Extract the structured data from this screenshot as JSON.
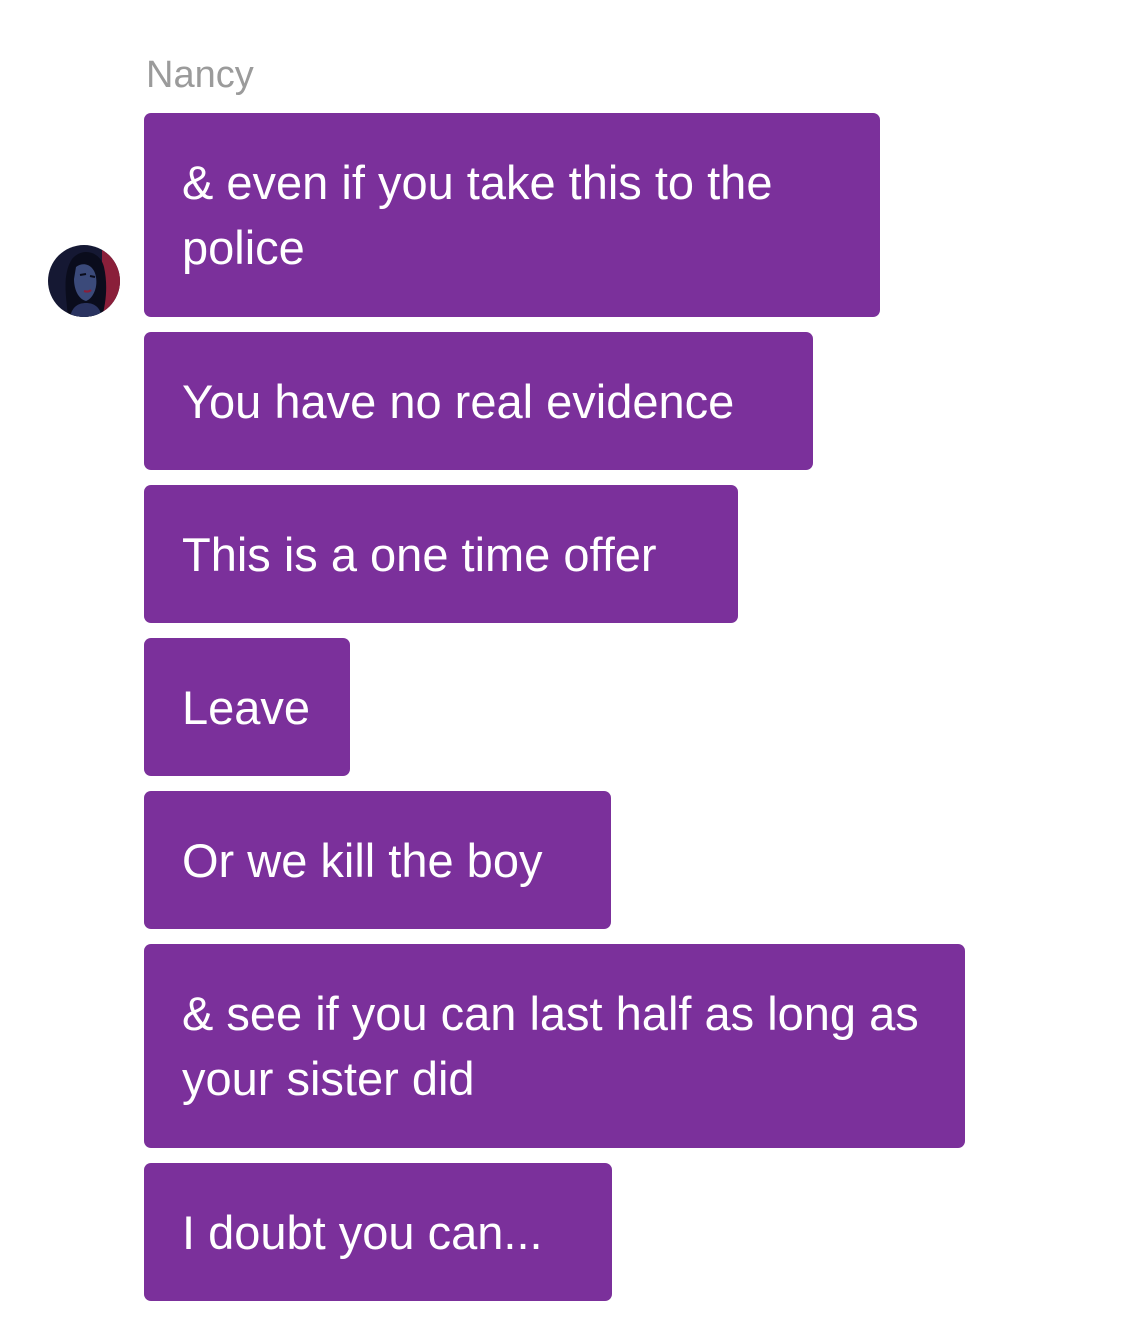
{
  "sender": {
    "name": "Nancy",
    "avatar_icon": "avatar-portrait-icon"
  },
  "colors": {
    "bubble": "#7b309b",
    "bubble_text": "#ffffff",
    "name_text": "#9b9b9b",
    "background": "#ffffff"
  },
  "messages": [
    {
      "text": "& even if you take this to the police"
    },
    {
      "text": "You have no real evidence"
    },
    {
      "text": "This is a one time offer"
    },
    {
      "text": "Leave"
    },
    {
      "text": "Or we kill the boy"
    },
    {
      "text": "& see if you can last half as long as your sister did"
    },
    {
      "text": "I doubt you can..."
    }
  ]
}
